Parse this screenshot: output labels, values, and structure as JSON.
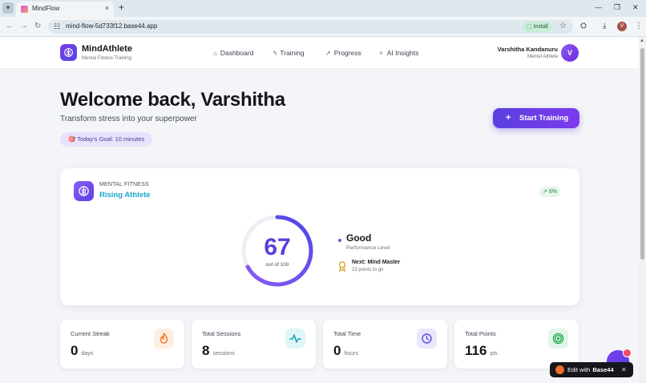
{
  "browser": {
    "tab_title": "MindFlow",
    "url": "mind-flow-5d733f12.base44.app",
    "install_label": "Install",
    "profile_initial": "V",
    "tab_close": "×",
    "new_tab": "+"
  },
  "header": {
    "brand": "MindAthlete",
    "brand_sub": "Mental Fitness Training",
    "nav": [
      {
        "label": "Dashboard",
        "icon": "home-icon"
      },
      {
        "label": "Training",
        "icon": "training-icon"
      },
      {
        "label": "Progress",
        "icon": "trend-icon"
      },
      {
        "label": "AI Insights",
        "icon": "sparkle-icon"
      }
    ],
    "user_name": "Varshitha Kandanuru",
    "user_role": "Mental Athlete",
    "avatar_initial": "V"
  },
  "hero": {
    "title": "Welcome back, Varshitha",
    "tagline": "Transform stress into your superpower",
    "goal": "🎯 Today's Goal: 10 minutes",
    "start_button": "Start Training",
    "start_plus": "+"
  },
  "fitness": {
    "label": "MENTAL FITNESS",
    "level": "Rising Athlete",
    "trend": "6%",
    "score": "67",
    "score_sub": "out of 100",
    "score_fraction": 0.67,
    "performance": "Good",
    "performance_sub": "Performance Level",
    "next": "Next: Mind Master",
    "next_sub": "23 points to go"
  },
  "stats": [
    {
      "title": "Current Streak",
      "value": "0",
      "unit": "days",
      "icon": "flame-icon",
      "color": "#f97316",
      "bg": "#fdeee2"
    },
    {
      "title": "Total Sessions",
      "value": "8",
      "unit": "sessions",
      "icon": "pulse-icon",
      "color": "#0ea5b7",
      "bg": "#e0f5f7"
    },
    {
      "title": "Total Time",
      "value": "0",
      "unit": "hours",
      "icon": "clock-icon",
      "color": "#5b4de0",
      "bg": "#e8e7fb"
    },
    {
      "title": "Total Points",
      "value": "116",
      "unit": "pts",
      "icon": "target-icon",
      "color": "#16a34a",
      "bg": "#e3f6ea"
    }
  ],
  "overlay": {
    "edit_text": "Edit with",
    "edit_brand": "Base44",
    "edit_close": "✕"
  },
  "colors": {
    "accent": "#5b3fe0",
    "level": "#1aa8c9",
    "trend": "#17803f"
  }
}
